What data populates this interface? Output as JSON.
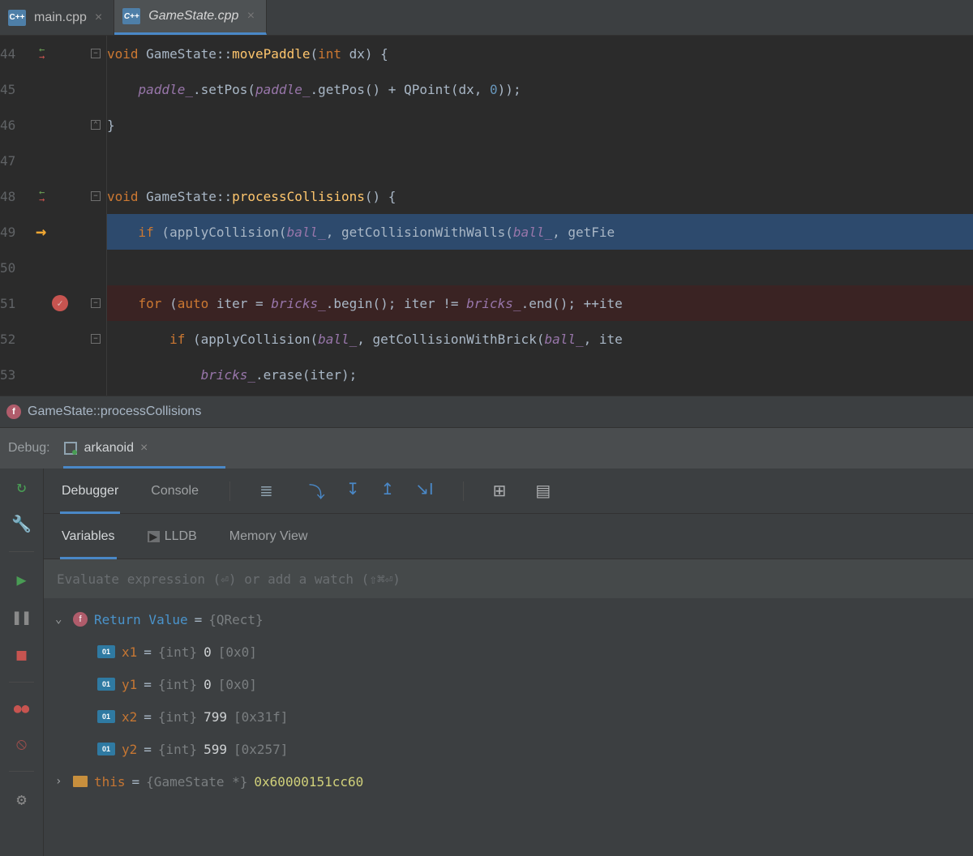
{
  "tabs": [
    {
      "name": "main.cpp",
      "active": false
    },
    {
      "name": "GameState.cpp",
      "active": true
    }
  ],
  "lines": {
    "l44": "44",
    "l45": "45",
    "l46": "46",
    "l47": "47",
    "l48": "48",
    "l49": "49",
    "l50": "50",
    "l51": "51",
    "l52": "52",
    "l53": "53"
  },
  "code": {
    "c44a": "void",
    "c44b": "GameState",
    "c44c": "::",
    "c44d": "movePaddle",
    "c44e": "(",
    "c44f": "int",
    "c44g": " dx) {",
    "c45a": "paddle_",
    "c45b": ".setPos(",
    "c45c": "paddle_",
    "c45d": ".getPos() + QPoint(dx, ",
    "c45e": "0",
    "c45f": "));",
    "c46a": "}",
    "c48a": "void",
    "c48b": "GameState",
    "c48c": "::",
    "c48d": "processCollisions",
    "c48e": "() {",
    "c49a": "if",
    "c49b": " (applyCollision(",
    "c49c": "ball_",
    "c49d": ", getCollisionWithWalls(",
    "c49e": "ball_",
    "c49f": ", getFie",
    "c51a": "for",
    "c51b": " (",
    "c51c": "auto",
    "c51d": " iter = ",
    "c51e": "bricks_",
    "c51f": ".begin(); iter != ",
    "c51g": "bricks_",
    "c51h": ".end(); ++ite",
    "c52a": "if",
    "c52b": " (applyCollision(",
    "c52c": "ball_",
    "c52d": ", getCollisionWithBrick(",
    "c52e": "ball_",
    "c52f": ", ite",
    "c53a": "bricks_",
    "c53b": ".erase(iter);"
  },
  "breadcrumb": "GameState::processCollisions",
  "debug": {
    "label": "Debug:",
    "config": "arkanoid",
    "tabs1": {
      "debugger": "Debugger",
      "console": "Console"
    },
    "tabs2": {
      "variables": "Variables",
      "lldb": "LLDB",
      "memory": "Memory View"
    },
    "watch_placeholder": "Evaluate expression (⏎) or add a watch (⇧⌘⏎)"
  },
  "vars": {
    "ret": {
      "name": "Return Value",
      "eq": " = ",
      "type": "{QRect}"
    },
    "x1": {
      "name": "x1",
      "eq": " = ",
      "type": "{int} ",
      "val": "0 ",
      "hex": "[0x0]"
    },
    "y1": {
      "name": "y1",
      "eq": " = ",
      "type": "{int} ",
      "val": "0 ",
      "hex": "[0x0]"
    },
    "x2": {
      "name": "x2",
      "eq": " = ",
      "type": "{int} ",
      "val": "799 ",
      "hex": "[0x31f]"
    },
    "y2": {
      "name": "y2",
      "eq": " = ",
      "type": "{int} ",
      "val": "599 ",
      "hex": "[0x257]"
    },
    "this": {
      "name": "this",
      "eq": " = ",
      "type": "{GameState *} ",
      "addr": "0x60000151cc60"
    }
  }
}
